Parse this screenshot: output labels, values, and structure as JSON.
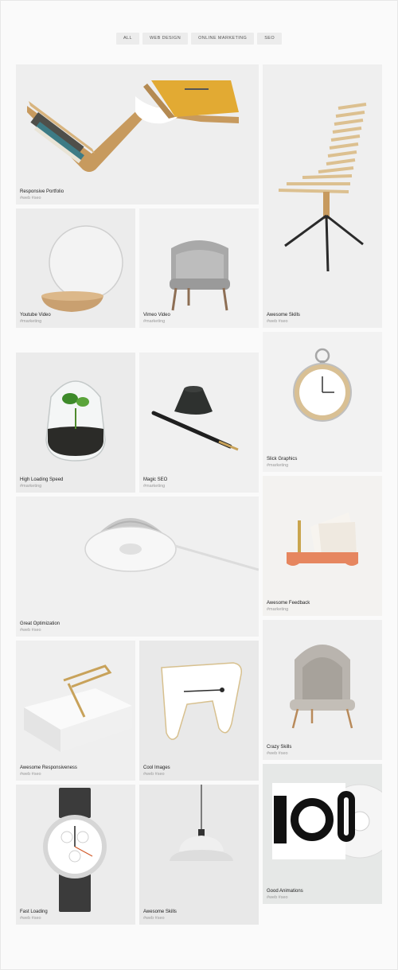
{
  "filters": [
    "ALL",
    "WEB DESIGN",
    "ONLINE MARKETING",
    "SEO"
  ],
  "items": [
    {
      "title": "Responsive Portfolio",
      "tags": "#web #seo",
      "icon": "bookshelf-image"
    },
    {
      "title": "Awesome Skills",
      "tags": "#web #seo",
      "icon": "chair-image"
    },
    {
      "title": "Youtube Video",
      "tags": "#marketing",
      "icon": "mirror-image"
    },
    {
      "title": "Vimeo Video",
      "tags": "#marketing",
      "icon": "armchair-image"
    },
    {
      "title": "High Loading Speed",
      "tags": "#marketing",
      "icon": "terrarium-image"
    },
    {
      "title": "Magic SEO",
      "tags": "#marketing",
      "icon": "pen-image"
    },
    {
      "title": "Slick Graphics",
      "tags": "#marketing",
      "icon": "clock-image"
    },
    {
      "title": "Great Optimization",
      "tags": "#web #seo",
      "icon": "lamp-image"
    },
    {
      "title": "Awesome Feedback",
      "tags": "#marketing",
      "icon": "letter-holder-image"
    },
    {
      "title": "Awesome Responsiveness",
      "tags": "#web #seo",
      "icon": "book-clip-image"
    },
    {
      "title": "Cool Images",
      "tags": "#web #seo",
      "icon": "stool-image"
    },
    {
      "title": "Crazy Skills",
      "tags": "#web #seo",
      "icon": "lounge-chair-image"
    },
    {
      "title": "Fast Loading",
      "tags": "#web #seo",
      "icon": "watch-image"
    },
    {
      "title": "Awesome Skills",
      "tags": "#web #seo",
      "icon": "pendant-lamp-image"
    },
    {
      "title": "Good Animations",
      "tags": "#web #seo",
      "icon": "vinyl-record-image"
    }
  ]
}
